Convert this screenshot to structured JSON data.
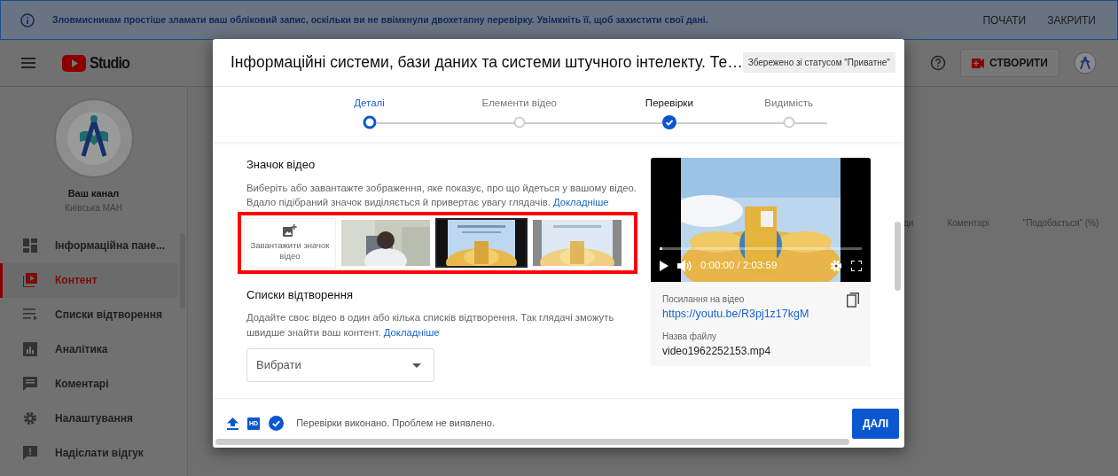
{
  "banner": {
    "message": "Зловмисникам простіше зламати ваш обліковий запис, оскільки ви не ввімкнули двохетапну перевірку. Увімкніть її, щоб захистити свої дані.",
    "actions": [
      "ПОЧАТИ",
      "ЗАКРИТИ"
    ]
  },
  "header": {
    "logo_text": "Studio",
    "create_button": "СТВОРИТИ"
  },
  "channel": {
    "title": "Ваш канал",
    "name": "Київська МАН"
  },
  "sidebar": {
    "items": [
      {
        "label": "Інформаційна пане...",
        "selected": false
      },
      {
        "label": "Контент",
        "selected": true
      },
      {
        "label": "Списки відтворення",
        "selected": false
      },
      {
        "label": "Аналітика",
        "selected": false
      },
      {
        "label": "Коментарі",
        "selected": false
      },
      {
        "label": "Налаштування",
        "selected": false
      },
      {
        "label": "Надіслати відгук",
        "selected": false
      }
    ]
  },
  "table": {
    "columns": [
      "ди",
      "Коментарі",
      "\"Подобається\" (%)"
    ]
  },
  "dialog": {
    "title": "Інформаційні системи, бази даних та системи штучного інтелекту. Те…",
    "save_status": "Збережено зі статусом \"Приватне\"",
    "steps": [
      {
        "label": "Деталі",
        "selected": true,
        "done": false
      },
      {
        "label": "Елементи відео",
        "selected": false,
        "done": false
      },
      {
        "label": "Перевірки",
        "selected": false,
        "done": true
      },
      {
        "label": "Видимість",
        "selected": false,
        "done": false
      }
    ],
    "thumbnail_section": {
      "heading": "Значок відео",
      "description": "Виберіть або завантажте зображення, яке показує, про що йдеться у вашому відео. Вдало підібраний значок виділяється й привертає увагу глядачів.",
      "link": "Докладніше",
      "upload_label": "Завантажити значок відео",
      "thumbnails": [
        {
          "kind": "picture",
          "selected": false
        },
        {
          "kind": "picture",
          "selected": true
        },
        {
          "kind": "picture",
          "selected": false
        }
      ]
    },
    "playlists": {
      "heading": "Списки відтворення",
      "description": "Додайте своє відео в один або кілька списків відтворення. Так глядачі зможуть швидше знайти ваш контент.",
      "link": "Докладніше",
      "select": {
        "placeholder": "Вибрати"
      }
    },
    "video": {
      "time": "0:00:00 / 2:03:59",
      "link_label": "Посилання на відео",
      "link": "https://youtu.be/R3pj1z17kgM",
      "file_label": "Назва файлу",
      "file_name": "video1962252153.mp4"
    },
    "footer": {
      "hd": "HD",
      "status": "Перевірки виконано. Проблем не виявлено.",
      "next_button": "ДАЛІ"
    }
  }
}
